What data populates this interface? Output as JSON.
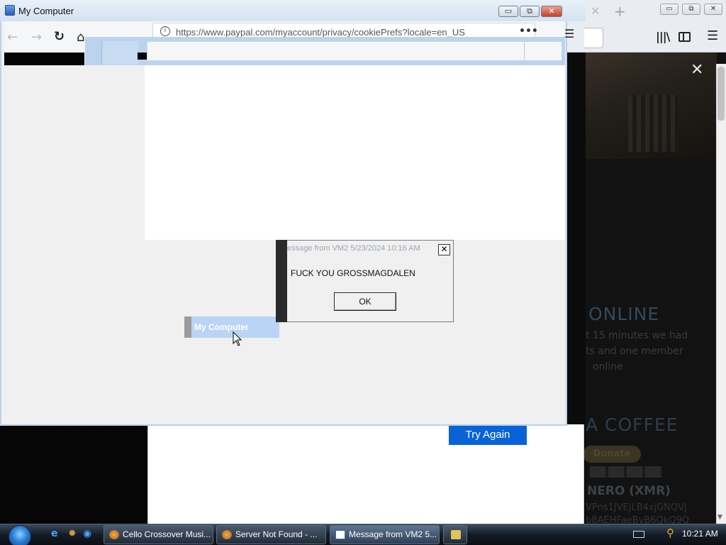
{
  "bg_browser": {
    "tab_close": "✕",
    "new_tab": "+",
    "min": "▭",
    "max": "⧉",
    "close": "✕",
    "page_close": "✕",
    "online_heading": "ONLINE",
    "stat_line1": "t 15 minutes we had",
    "stat_line2": "ts and one member",
    "stat_line3": "online",
    "coffee_heading": "A COFFEE",
    "donate_label": "Donate",
    "monero_heading": "NERO (XMR)",
    "addr_line1": "VPns1JVEjLB4xjGNQVJ",
    "addr_line2": "b8AEHFaeByB6QkQ9Q",
    "try_again_label": "Try Again"
  },
  "firefox": {
    "url": "https://www.paypal.com/myaccount/privacy/cookiePrefs?locale=en_US",
    "dots": "•••",
    "info_icon": "i",
    "back": "←",
    "forward": "→",
    "reload": "↻",
    "home": "⌂",
    "menu": "☰"
  },
  "my_computer": {
    "title": "My Computer",
    "min": "▭",
    "max": "⧉",
    "close": "✕",
    "selected_item_label": "My Computer"
  },
  "message_box": {
    "title": "essage from VM2 5/23/2024 10:16 AM",
    "close": "✕",
    "text": "FUCK YOU GROSSMAGDALEN",
    "ok_label": "OK"
  },
  "taskbar": {
    "items": [
      {
        "label": "Cello Crossover Musi..."
      },
      {
        "label": "Server Not Found - ..."
      },
      {
        "label": "Message from VM2 5..."
      }
    ],
    "clock": "10:21 AM"
  }
}
